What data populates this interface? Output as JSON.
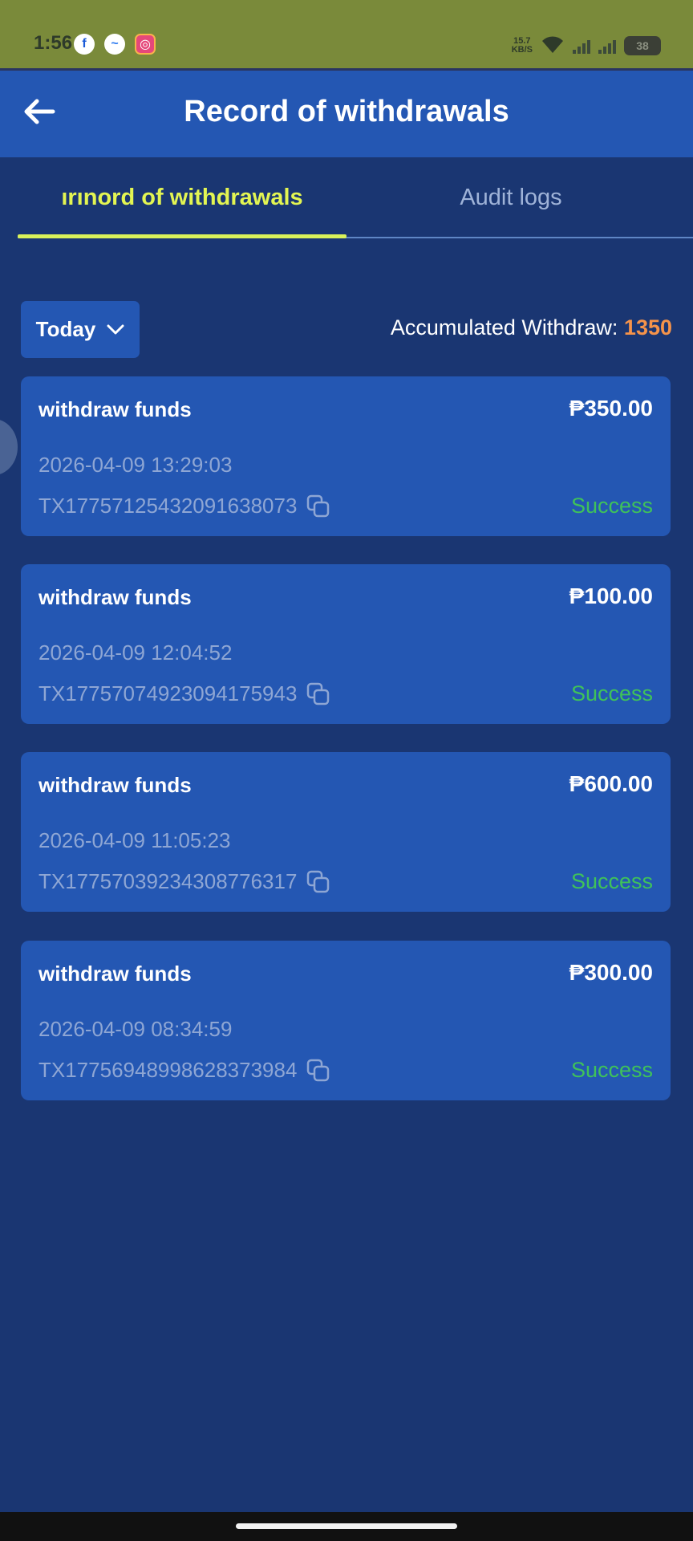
{
  "status_bar": {
    "time": "1:56",
    "apps": [
      "facebook-icon",
      "messenger-icon",
      "instagram-icon"
    ],
    "net_speed_value": "15.7",
    "net_speed_unit": "KB/S",
    "battery": "38"
  },
  "header": {
    "title": "Record of withdrawals",
    "back_icon": "back-arrow-icon"
  },
  "tabs": [
    {
      "label": "ırınord of withdrawals",
      "active": true
    },
    {
      "label": "Audit logs",
      "active": false
    }
  ],
  "filter": {
    "selected": "Today",
    "accumulated_label": "Accumulated Withdraw: ",
    "accumulated_value": "1350"
  },
  "records": [
    {
      "name": "withdraw funds",
      "amount": "₱350.00",
      "time": "2026-04-09 13:29:03",
      "txid": "TX17757125432091638073",
      "status": "Success"
    },
    {
      "name": "withdraw funds",
      "amount": "₱100.00",
      "time": "2026-04-09 12:04:52",
      "txid": "TX17757074923094175943",
      "status": "Success"
    },
    {
      "name": "withdraw funds",
      "amount": "₱600.00",
      "time": "2026-04-09 11:05:23",
      "txid": "TX17757039234308776317",
      "status": "Success"
    },
    {
      "name": "withdraw funds",
      "amount": "₱300.00",
      "time": "2026-04-09 08:34:59",
      "txid": "TX17756948998628373984",
      "status": "Success"
    }
  ],
  "colors": {
    "background": "#1a3672",
    "card": "#2457b3",
    "active_tab": "#e3f552",
    "accumulated_value": "#f5934a",
    "success": "#3fc25a"
  }
}
